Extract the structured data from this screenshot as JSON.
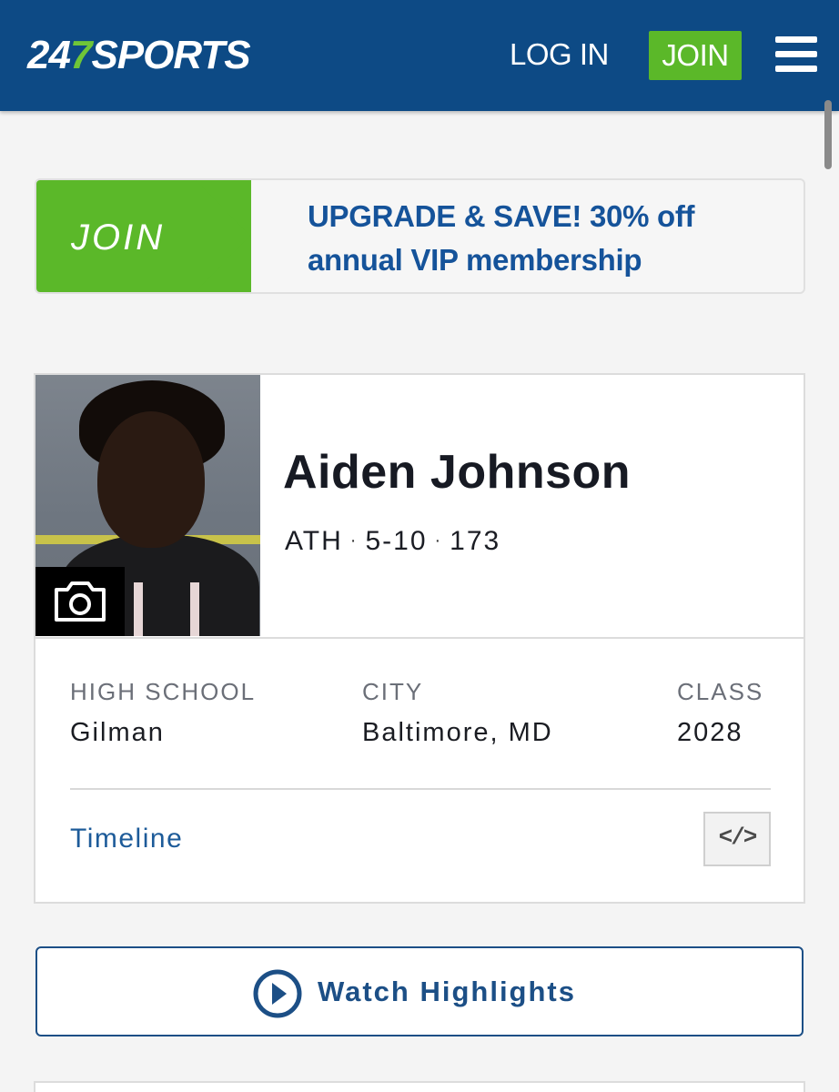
{
  "header": {
    "logo_prefix": "24",
    "logo_seven": "7",
    "logo_suffix": "SPORTS",
    "login_label": "LOG IN",
    "join_label": "JOIN",
    "menu_icon": "hamburger-menu-icon"
  },
  "promo": {
    "join_label": "JOIN",
    "text": "UPGRADE & SAVE! 30% off annual VIP membership"
  },
  "player": {
    "name": "Aiden Johnson",
    "position": "ATH",
    "height": "5-10",
    "weight": "173",
    "photo_icon": "camera-icon",
    "high_school_label": "HIGH SCHOOL",
    "high_school": "Gilman",
    "city_label": "CITY",
    "city": "Baltimore, MD",
    "class_label": "CLASS",
    "class_year": "2028",
    "timeline_label": "Timeline",
    "embed_label": "</>"
  },
  "highlights": {
    "label": "Watch Highlights",
    "icon": "play-circle-icon"
  },
  "colors": {
    "header_blue": "#0d4a85",
    "brand_green": "#5bb829",
    "link_blue": "#1d5b99"
  }
}
